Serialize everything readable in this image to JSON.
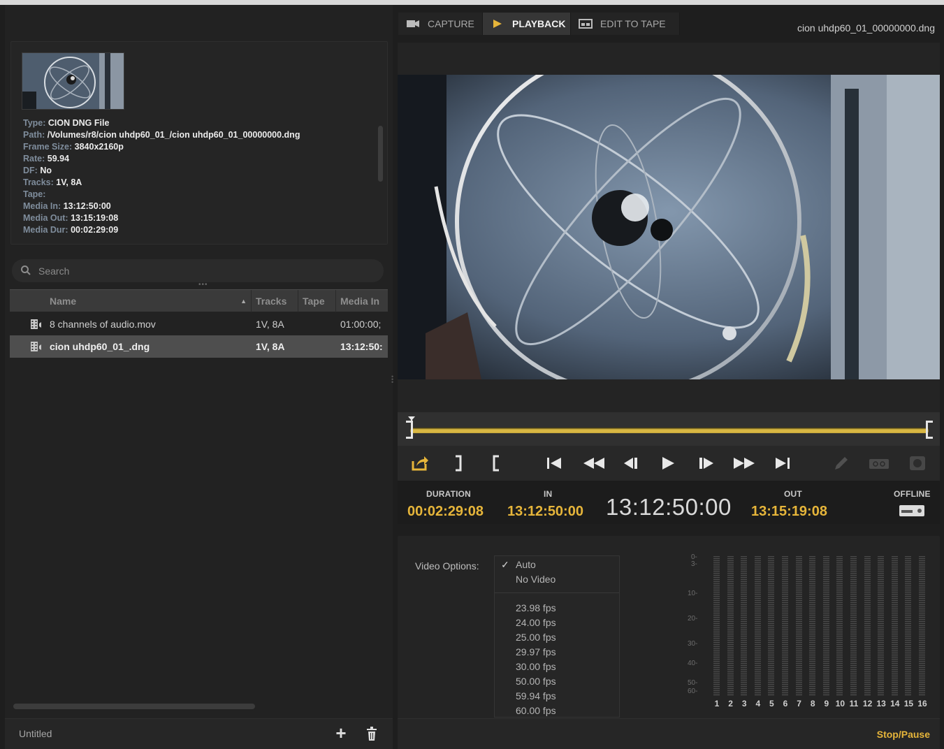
{
  "tabs": [
    {
      "label": "CAPTURE",
      "icon": "camera-icon"
    },
    {
      "label": "PLAYBACK",
      "icon": "play-icon"
    },
    {
      "label": "EDIT TO TAPE",
      "icon": "tape-icon"
    }
  ],
  "active_tab": "PLAYBACK",
  "file_title": "cion uhdp60_01_00000000.dng",
  "info": {
    "lines": [
      {
        "key": "Type:",
        "value": "CION DNG File"
      },
      {
        "key": "Path:",
        "value": "/Volumes/r8/cion uhdp60_01_/cion uhdp60_01_00000000.dng"
      },
      {
        "key": "Frame Size:",
        "value": "3840x2160p"
      },
      {
        "key": "Rate:",
        "value": "59.94"
      },
      {
        "key": "DF:",
        "value": "No"
      },
      {
        "key": "Tracks:",
        "value": "1V, 8A"
      },
      {
        "key": "Tape:",
        "value": ""
      },
      {
        "key": "Media In:",
        "value": "13:12:50:00"
      },
      {
        "key": "Media Out:",
        "value": "13:15:19:08"
      },
      {
        "key": "Media Dur:",
        "value": "00:02:29:09"
      }
    ]
  },
  "search": {
    "placeholder": "Search"
  },
  "table": {
    "columns": [
      "Name",
      "Tracks",
      "Tape",
      "Media In"
    ],
    "rows": [
      {
        "name": "8 channels of audio.mov",
        "tracks": "1V, 8A",
        "tape": "",
        "media_in": "01:00:00;",
        "selected": false
      },
      {
        "name": "cion uhdp60_01_.dng",
        "tracks": "1V, 8A",
        "tape": "",
        "media_in": "13:12:50:",
        "selected": true
      }
    ]
  },
  "footer": {
    "project": "Untitled",
    "add_label": "+",
    "status": "Stop/Pause"
  },
  "timecodes": {
    "duration_label": "DURATION",
    "duration": "00:02:29:08",
    "in_label": "IN",
    "in": "13:12:50:00",
    "current": "13:12:50:00",
    "out_label": "OUT",
    "out": "13:15:19:08",
    "offline_label": "OFFLINE"
  },
  "scrubber": {
    "position": 0.0
  },
  "video_options": {
    "label": "Video Options:",
    "items": [
      "Auto",
      "No Video",
      "23.98 fps",
      "24.00 fps",
      "25.00 fps",
      "29.97 fps",
      "30.00 fps",
      "50.00 fps",
      "59.94 fps",
      "60.00 fps"
    ],
    "checked": "Auto",
    "check_mark": "✓"
  },
  "meters": {
    "scale": [
      "0-",
      "3-",
      "10-",
      "20-",
      "30-",
      "40-",
      "50-",
      "60-"
    ],
    "channels": [
      "1",
      "2",
      "3",
      "4",
      "5",
      "6",
      "7",
      "8",
      "9",
      "10",
      "11",
      "12",
      "13",
      "14",
      "15",
      "16"
    ]
  },
  "colors": {
    "accent": "#e6b53a",
    "panel": "#242424",
    "selected_row": "#4e4e4e"
  }
}
